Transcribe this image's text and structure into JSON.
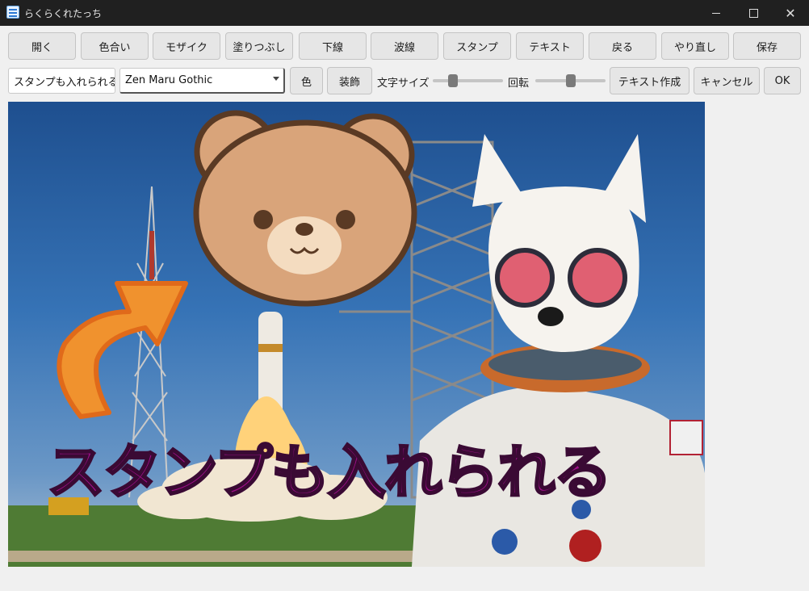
{
  "window": {
    "title": "らくらくれたっち"
  },
  "toolbar": {
    "buttons": [
      "開く",
      "色合い",
      "モザイク",
      "塗りつぶし",
      "下線",
      "波線",
      "スタンプ",
      "テキスト",
      "戻る",
      "やり直し",
      "保存"
    ]
  },
  "text_options": {
    "text_value": "スタンプも入れられる",
    "font": "Zen Maru Gothic",
    "color_label": "色",
    "decoration_label": "装飾",
    "size_label": "文字サイズ",
    "rotation_label": "回転",
    "size_level": 0.25,
    "rotation_level": 0.5,
    "create_label": "テキスト作成",
    "cancel_label": "キャンセル",
    "ok_label": "OK"
  },
  "canvas": {
    "overlay_text": "スタンプも入れられる",
    "overlay_color": "#a00f8a",
    "stamps": [
      "bear-face-icon",
      "curved-arrow-icon"
    ]
  }
}
